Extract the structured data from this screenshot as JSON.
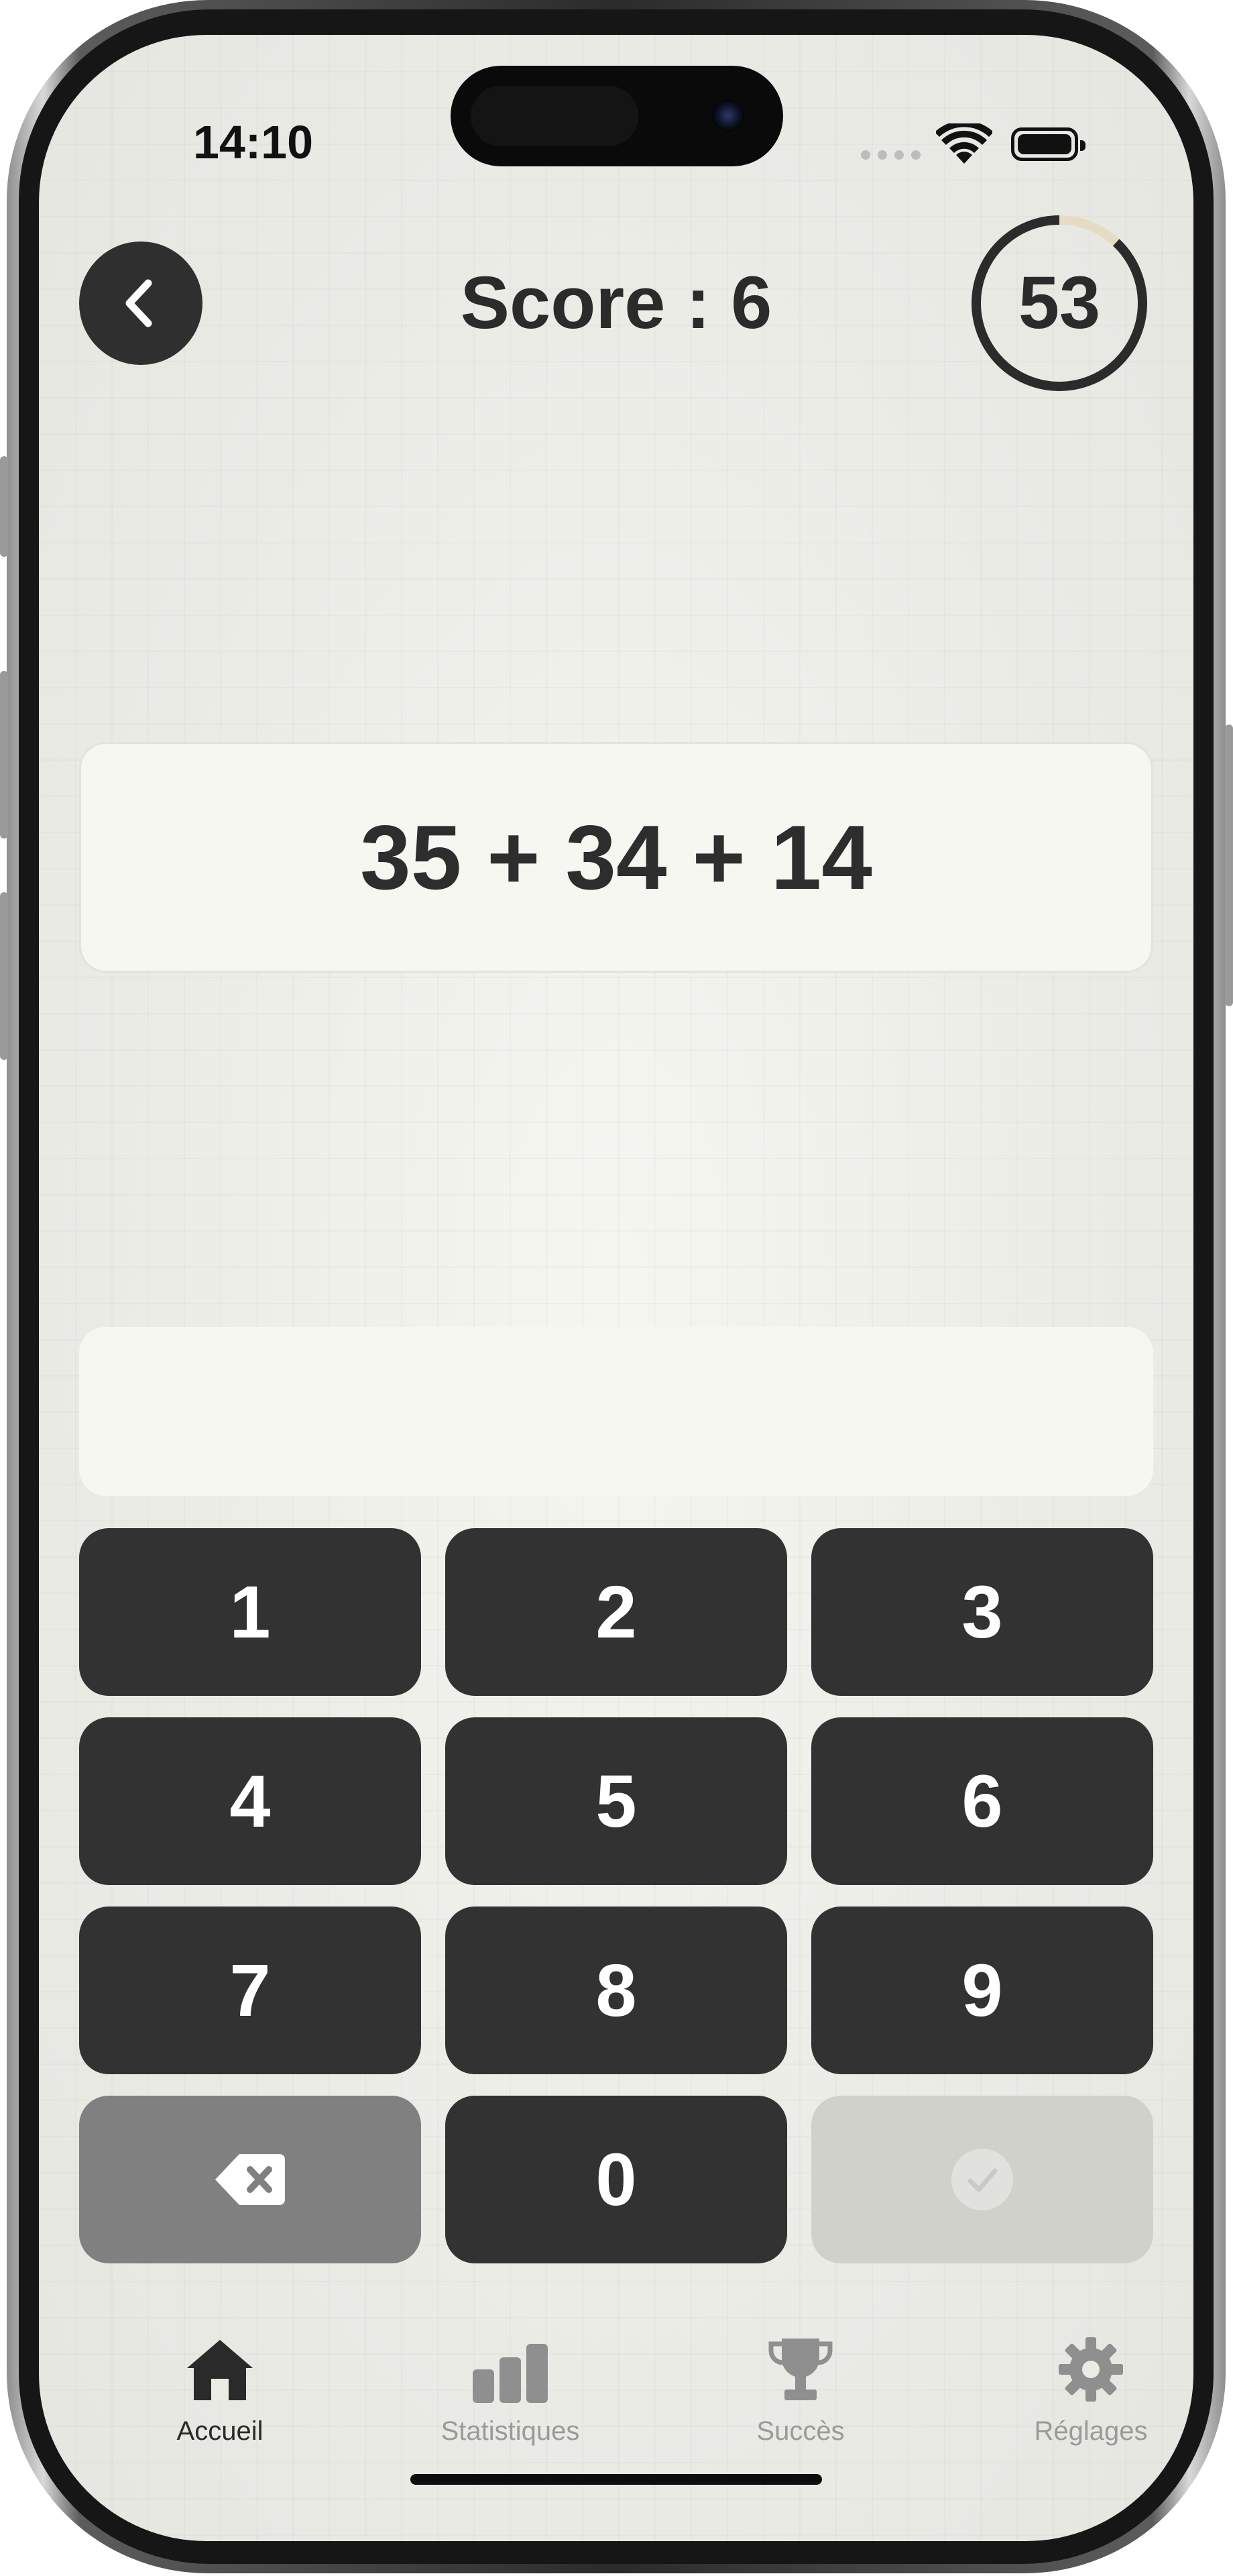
{
  "status_bar": {
    "time": "14:10"
  },
  "header": {
    "score": "Score : 6",
    "timer_seconds": "53",
    "timer_progress": 0.12
  },
  "question": {
    "text": "35 + 34 + 14"
  },
  "answer": {
    "value": ""
  },
  "keypad": {
    "keys": [
      "1",
      "2",
      "3",
      "4",
      "5",
      "6",
      "7",
      "8",
      "9"
    ],
    "zero": "0"
  },
  "tabs": [
    {
      "label": "Accueil",
      "icon": "home-icon",
      "active": true
    },
    {
      "label": "Statistiques",
      "icon": "bar-chart-icon",
      "active": false
    },
    {
      "label": "Succès",
      "icon": "trophy-icon",
      "active": false
    },
    {
      "label": "Réglages",
      "icon": "gear-icon",
      "active": false
    }
  ],
  "colors": {
    "key_bg": "#323232",
    "delete_bg": "#808080",
    "confirm_bg": "#d1d1cc",
    "timer_remaining": "#e6dcc6",
    "ink": "#2b2b2b"
  }
}
